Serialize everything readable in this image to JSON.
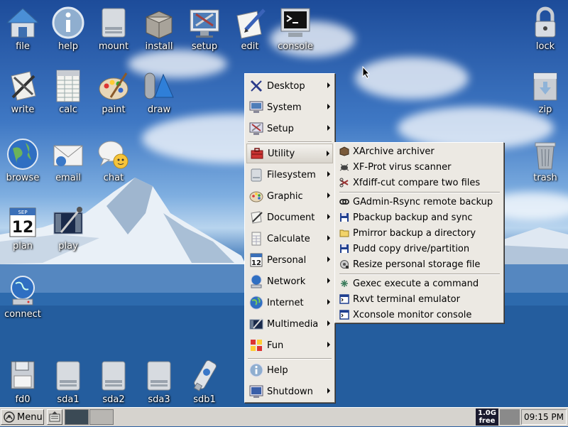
{
  "desktop_icons": {
    "file": "file",
    "help": "help",
    "mount": "mount",
    "install": "install",
    "setup": "setup",
    "edit": "edit",
    "console": "console",
    "lock": "lock",
    "write": "write",
    "calc": "calc",
    "paint": "paint",
    "draw": "draw",
    "zip": "zip",
    "browse": "browse",
    "email": "email",
    "chat": "chat",
    "trash": "trash",
    "plan": "plan",
    "play": "play",
    "connect": "connect",
    "fd0": "fd0",
    "sda1": "sda1",
    "sda2": "sda2",
    "sda3": "sda3",
    "sdb1": "sdb1"
  },
  "calendar_icon": {
    "month": "SEP",
    "day": "12"
  },
  "main_menu": {
    "items": [
      {
        "label": "Desktop",
        "icon": "x-logo-icon",
        "submenu": true
      },
      {
        "label": "System",
        "icon": "monitor-icon",
        "submenu": true
      },
      {
        "label": "Setup",
        "icon": "setup-icon",
        "submenu": true
      },
      {
        "label": "Utility",
        "icon": "toolbox-icon",
        "submenu": true,
        "selected": true
      },
      {
        "label": "Filesystem",
        "icon": "folder-icon",
        "submenu": true
      },
      {
        "label": "Graphic",
        "icon": "palette-icon",
        "submenu": true
      },
      {
        "label": "Document",
        "icon": "document-icon",
        "submenu": true
      },
      {
        "label": "Calculate",
        "icon": "calculator-icon",
        "submenu": true
      },
      {
        "label": "Personal",
        "icon": "calendar-icon",
        "submenu": true
      },
      {
        "label": "Network",
        "icon": "network-icon",
        "submenu": true
      },
      {
        "label": "Internet",
        "icon": "globe-icon",
        "submenu": true
      },
      {
        "label": "Multimedia",
        "icon": "multimedia-icon",
        "submenu": true
      },
      {
        "label": "Fun",
        "icon": "fun-icon",
        "submenu": true
      },
      {
        "label": "Help",
        "icon": "help-icon",
        "submenu": false
      },
      {
        "label": "Shutdown",
        "icon": "shutdown-icon",
        "submenu": true
      }
    ]
  },
  "utility_submenu": {
    "items": [
      {
        "label": "XArchive archiver",
        "icon": "archive-icon"
      },
      {
        "label": "XF-Prot virus scanner",
        "icon": "virus-scanner-icon"
      },
      {
        "label": "Xfdiff-cut compare two files",
        "icon": "diff-icon"
      },
      {
        "label": "GAdmin-Rsync remote backup",
        "icon": "rsync-icon"
      },
      {
        "label": "Pbackup backup and sync",
        "icon": "floppy-icon"
      },
      {
        "label": "Pmirror backup a directory",
        "icon": "folder-icon"
      },
      {
        "label": "Pudd copy drive/partition",
        "icon": "floppy-icon"
      },
      {
        "label": "Resize personal storage file",
        "icon": "resize-icon"
      },
      {
        "label": "Gexec execute a command",
        "icon": "gexec-icon"
      },
      {
        "label": "Rxvt terminal emulator",
        "icon": "terminal-icon"
      },
      {
        "label": "Xconsole monitor console",
        "icon": "terminal-icon"
      }
    ]
  },
  "taskbar": {
    "menu_label": "Menu",
    "memory_line1": "1.0G",
    "memory_line2": "free",
    "clock": "09:15 PM"
  },
  "colors": {
    "menu_bg": "#ece9e3",
    "taskbar_bg": "#d6d3ce",
    "desktop_label": "#ffffff"
  }
}
